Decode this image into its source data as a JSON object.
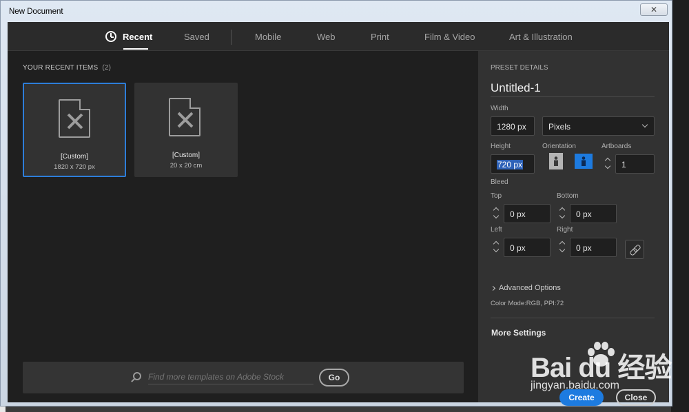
{
  "window": {
    "title": "New Document",
    "close_glyph": "✕"
  },
  "tabs": [
    {
      "label": "Recent",
      "active": true,
      "icon": "clock-icon"
    },
    {
      "label": "Saved"
    },
    {
      "label": "Mobile"
    },
    {
      "label": "Web"
    },
    {
      "label": "Print"
    },
    {
      "label": "Film & Video"
    },
    {
      "label": "Art & Illustration"
    }
  ],
  "recent": {
    "heading": "YOUR RECENT ITEMS",
    "count": "(2)",
    "items": [
      {
        "name": "[Custom]",
        "size": "1820 x 720 px",
        "selected": true
      },
      {
        "name": "[Custom]",
        "size": "20 x 20 cm",
        "selected": false
      }
    ]
  },
  "stock": {
    "placeholder": "Find more templates on Adobe Stock",
    "go_label": "Go"
  },
  "preset": {
    "heading": "PRESET DETAILS",
    "title": "Untitled-1",
    "width_label": "Width",
    "width_value": "1280 px",
    "unit": "Pixels",
    "height_label": "Height",
    "height_value": "720 px",
    "orientation_label": "Orientation",
    "artboards_label": "Artboards",
    "artboards_value": "1",
    "bleed_label": "Bleed",
    "top_label": "Top",
    "top_value": "0 px",
    "bottom_label": "Bottom",
    "bottom_value": "0 px",
    "left_label": "Left",
    "left_value": "0 px",
    "right_label": "Right",
    "right_value": "0 px",
    "advanced_label": "Advanced Options",
    "color_mode": "Color Mode:RGB, PPI:72",
    "more_settings": "More Settings",
    "create_label": "Create",
    "close_label": "Close"
  },
  "watermark": {
    "brand": "Bai du 经验",
    "url": "jingyan.baidu.com"
  },
  "colors": {
    "accent": "#1d7be0",
    "panel": "#323232",
    "background": "#1f1f1f"
  }
}
